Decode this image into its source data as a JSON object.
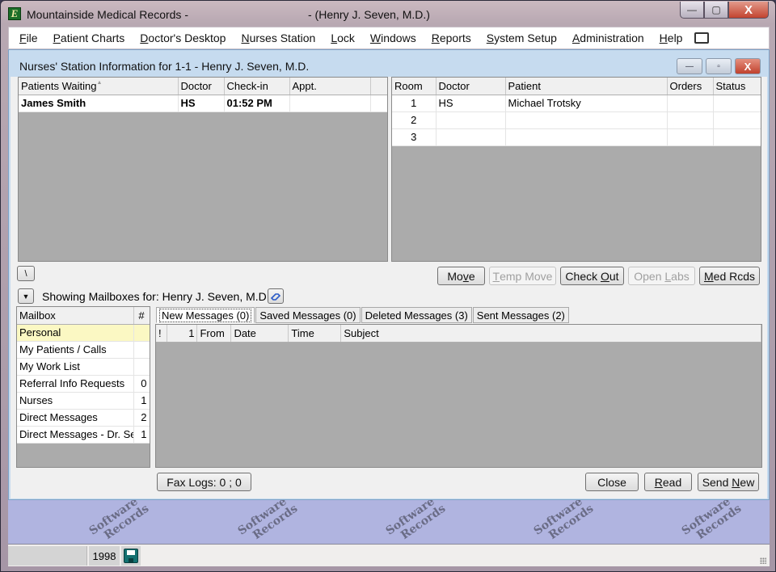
{
  "window": {
    "app_icon": "E",
    "title_left": "Mountainside Medical Records -",
    "title_right": "- (Henry J. Seven, M.D.)",
    "minimize": "—",
    "maximize": "▢",
    "close": "X"
  },
  "menu": {
    "items": [
      {
        "label": "File",
        "accel": "F",
        "rest": "ile"
      },
      {
        "label": "Patient Charts",
        "accel": "P",
        "rest": "atient Charts"
      },
      {
        "label": "Doctor's Desktop",
        "accel": "D",
        "rest": "octor's Desktop"
      },
      {
        "label": "Nurses Station",
        "accel": "N",
        "rest": "urses Station"
      },
      {
        "label": "Lock",
        "accel": "L",
        "rest": "ock"
      },
      {
        "label": "Windows",
        "accel": "W",
        "rest": "indows"
      },
      {
        "label": "Reports",
        "accel": "R",
        "rest": "eports"
      },
      {
        "label": "System Setup",
        "accel": "S",
        "rest": "ystem Setup"
      },
      {
        "label": "Administration",
        "accel": "A",
        "rest": "dministration"
      },
      {
        "label": "Help",
        "accel": "H",
        "rest": "elp"
      }
    ],
    "extra_icon": "folder-icon"
  },
  "child_window": {
    "title": "Nurses' Station Information for 1-1 - Henry J. Seven, M.D.",
    "minimize": "—",
    "maximize": "▫",
    "close": "X"
  },
  "waiting": {
    "columns": [
      "Patients Waiting",
      "Doctor",
      "Check-in",
      "Appt.",
      ""
    ],
    "sort_indicator": "▲",
    "rows": [
      [
        "James Smith",
        "HS",
        "01:52 PM",
        "",
        ""
      ]
    ]
  },
  "rooms": {
    "columns": [
      "Room",
      "Doctor",
      "Patient",
      "Orders",
      "Status"
    ],
    "rows": [
      [
        "1",
        "HS",
        "Michael Trotsky",
        "",
        ""
      ],
      [
        "2",
        "",
        "",
        "",
        ""
      ],
      [
        "3",
        "",
        "",
        "",
        ""
      ]
    ]
  },
  "actions": {
    "backslash": "\\",
    "move": {
      "pre": "Mo",
      "accel": "v",
      "post": "e"
    },
    "temp_move": {
      "pre": "",
      "accel": "T",
      "post": "emp Move"
    },
    "check_out": {
      "pre": "Check ",
      "accel": "O",
      "post": "ut"
    },
    "open_labs": {
      "pre": "Open ",
      "accel": "L",
      "post": "abs"
    },
    "med_rcds": {
      "pre": "",
      "accel": "M",
      "post": "ed Rcds"
    }
  },
  "mailbox_header": {
    "dropdown": "▼",
    "label": "Showing Mailboxes for: Henry J. Seven, M.D.",
    "icon": "link-icon"
  },
  "mailboxes": {
    "columns": [
      "Mailbox",
      "#"
    ],
    "rows": [
      {
        "name": "Personal",
        "count": "",
        "selected": true
      },
      {
        "name": "My Patients / Calls",
        "count": ""
      },
      {
        "name": "My Work List",
        "count": ""
      },
      {
        "name": "Referral Info Requests",
        "count": "0"
      },
      {
        "name": "Nurses",
        "count": "1"
      },
      {
        "name": "Direct Messages",
        "count": "2"
      },
      {
        "name": "Direct Messages - Dr. Se",
        "count": "1"
      }
    ]
  },
  "message_tabs": [
    "New Messages (0)",
    "Saved Messages (0)",
    "Deleted Messages (3)",
    "Sent Messages (2)"
  ],
  "messages": {
    "columns": [
      "!",
      "1",
      "From",
      "Date",
      "Time",
      "Subject"
    ]
  },
  "footer": {
    "fax_logs": "Fax Logs: 0 ; 0",
    "close": "Close",
    "read": {
      "accel": "R",
      "post": "ead"
    },
    "send_new": {
      "pre": "Send ",
      "accel": "N",
      "post": "ew"
    }
  },
  "watermark": {
    "line1": "Software",
    "line2": "Records"
  },
  "statusbar": {
    "year": "1998",
    "icon": "floppy-disk-icon"
  }
}
